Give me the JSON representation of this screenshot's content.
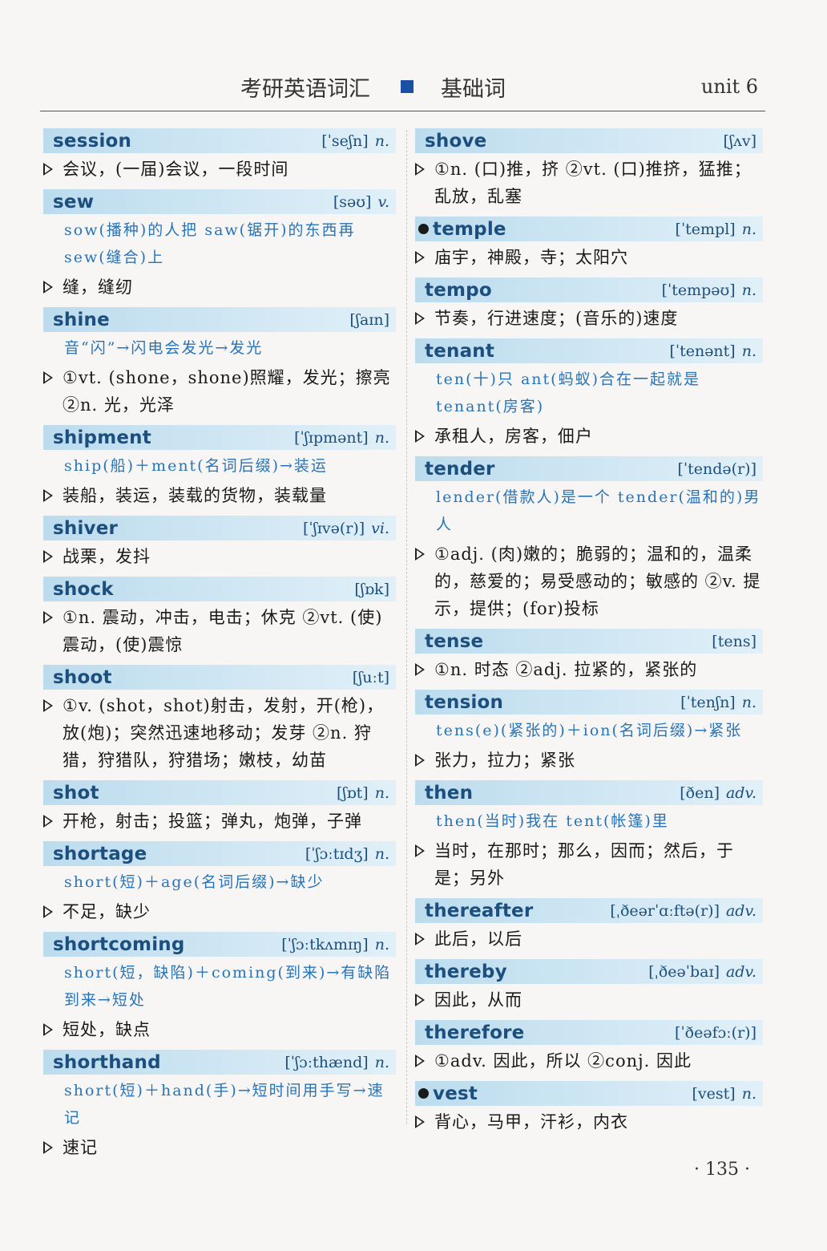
{
  "header": {
    "book_title": "考研英语词汇",
    "section": "基础词",
    "unit": "unit 6"
  },
  "left_entries": [
    {
      "word": "session",
      "marked": false,
      "pron": "[ˈseʃn]",
      "pos": "n.",
      "mnemonic": "",
      "defs": [
        "会议，(一届)会议，一段时间"
      ]
    },
    {
      "word": "sew",
      "marked": false,
      "pron": "[səʊ]",
      "pos": "v.",
      "mnemonic": "sow(播种)的人把 saw(锯开)的东西再 sew(缝合)上",
      "defs": [
        "缝，缝纫"
      ]
    },
    {
      "word": "shine",
      "marked": false,
      "pron": "[ʃaɪn]",
      "pos": "",
      "mnemonic": "音“闪”→闪电会发光→发光",
      "defs": [
        "①vt. (shone，shone)照耀，发光；擦亮 ②n. 光，光泽"
      ]
    },
    {
      "word": "shipment",
      "marked": false,
      "pron": "[ˈʃɪpmənt]",
      "pos": "n.",
      "mnemonic": "ship(船)＋ment(名词后缀)→装运",
      "defs": [
        "装船，装运，装载的货物，装载量"
      ]
    },
    {
      "word": "shiver",
      "marked": false,
      "pron": "[ˈʃɪvə(r)]",
      "pos": "vi.",
      "mnemonic": "",
      "defs": [
        "战栗，发抖"
      ]
    },
    {
      "word": "shock",
      "marked": false,
      "pron": "[ʃɒk]",
      "pos": "",
      "mnemonic": "",
      "defs": [
        "①n. 震动，冲击，电击；休克 ②vt. (使)震动，(使)震惊"
      ]
    },
    {
      "word": "shoot",
      "marked": false,
      "pron": "[ʃuːt]",
      "pos": "",
      "mnemonic": "",
      "defs": [
        "①v. (shot，shot)射击，发射，开(枪)，放(炮)；突然迅速地移动；发芽 ②n. 狩猎，狩猎队，狩猎场；嫩枝，幼苗"
      ]
    },
    {
      "word": "shot",
      "marked": false,
      "pron": "[ʃɒt]",
      "pos": "n.",
      "mnemonic": "",
      "defs": [
        "开枪，射击；投篮；弹丸，炮弹，子弹"
      ]
    },
    {
      "word": "shortage",
      "marked": false,
      "pron": "[ˈʃɔːtɪdʒ]",
      "pos": "n.",
      "mnemonic": "short(短)＋age(名词后缀)→缺少",
      "defs": [
        "不足，缺少"
      ]
    },
    {
      "word": "shortcoming",
      "marked": false,
      "pron": "[ˈʃɔːtkʌmɪŋ]",
      "pos": "n.",
      "mnemonic": "short(短，缺陷)＋coming(到来)→有缺陷到来→短处",
      "defs": [
        "短处，缺点"
      ]
    },
    {
      "word": "shorthand",
      "marked": false,
      "pron": "[ˈʃɔːthænd]",
      "pos": "n.",
      "mnemonic": "short(短)＋hand(手)→短时间用手写→速记",
      "defs": [
        "速记"
      ]
    }
  ],
  "right_entries": [
    {
      "word": "shove",
      "marked": false,
      "pron": "[ʃʌv]",
      "pos": "",
      "mnemonic": "",
      "defs": [
        "①n. (口)推，挤 ②vt. (口)推挤，猛推；乱放，乱塞"
      ]
    },
    {
      "word": "temple",
      "marked": true,
      "pron": "[ˈtempl]",
      "pos": "n.",
      "mnemonic": "",
      "defs": [
        "庙宇，神殿，寺；太阳穴"
      ]
    },
    {
      "word": "tempo",
      "marked": false,
      "pron": "[ˈtempəʊ]",
      "pos": "n.",
      "mnemonic": "",
      "defs": [
        "节奏，行进速度；(音乐的)速度"
      ]
    },
    {
      "word": "tenant",
      "marked": false,
      "pron": "[ˈtenənt]",
      "pos": "n.",
      "mnemonic": "ten(十)只 ant(蚂蚁)合在一起就是 tenant(房客)",
      "defs": [
        "承租人，房客，佃户"
      ]
    },
    {
      "word": "tender",
      "marked": false,
      "pron": "[ˈtendə(r)]",
      "pos": "",
      "mnemonic": "lender(借款人)是一个 tender(温和的)男人",
      "defs": [
        "①adj. (肉)嫩的；脆弱的；温和的，温柔的，慈爱的；易受感动的；敏感的 ②v. 提示，提供；(for)投标"
      ]
    },
    {
      "word": "tense",
      "marked": false,
      "pron": "[tens]",
      "pos": "",
      "mnemonic": "",
      "defs": [
        "①n. 时态 ②adj. 拉紧的，紧张的"
      ]
    },
    {
      "word": "tension",
      "marked": false,
      "pron": "[ˈtenʃn]",
      "pos": "n.",
      "mnemonic": "tens(e)(紧张的)＋ion(名词后缀)→紧张",
      "defs": [
        "张力，拉力；紧张"
      ]
    },
    {
      "word": "then",
      "marked": false,
      "pron": "[ðen]",
      "pos": "adv.",
      "mnemonic": "then(当时)我在 tent(帐篷)里",
      "defs": [
        "当时，在那时；那么，因而；然后，于是；另外"
      ]
    },
    {
      "word": "thereafter",
      "marked": false,
      "pron": "[ˌðeərˈɑːftə(r)]",
      "pos": "adv.",
      "mnemonic": "",
      "defs": [
        "此后，以后"
      ]
    },
    {
      "word": "thereby",
      "marked": false,
      "pron": "[ˌðeəˈbaɪ]",
      "pos": "adv.",
      "mnemonic": "",
      "defs": [
        "因此，从而"
      ]
    },
    {
      "word": "therefore",
      "marked": false,
      "pron": "[ˈðeəfɔː(r)]",
      "pos": "",
      "mnemonic": "",
      "defs": [
        "①adv. 因此，所以 ②conj. 因此"
      ]
    },
    {
      "word": "vest",
      "marked": true,
      "pron": "[vest]",
      "pos": "n.",
      "mnemonic": "",
      "defs": [
        "背心，马甲，汗衫，内衣"
      ]
    }
  ],
  "footer": {
    "page_number": "· 135 ·"
  }
}
